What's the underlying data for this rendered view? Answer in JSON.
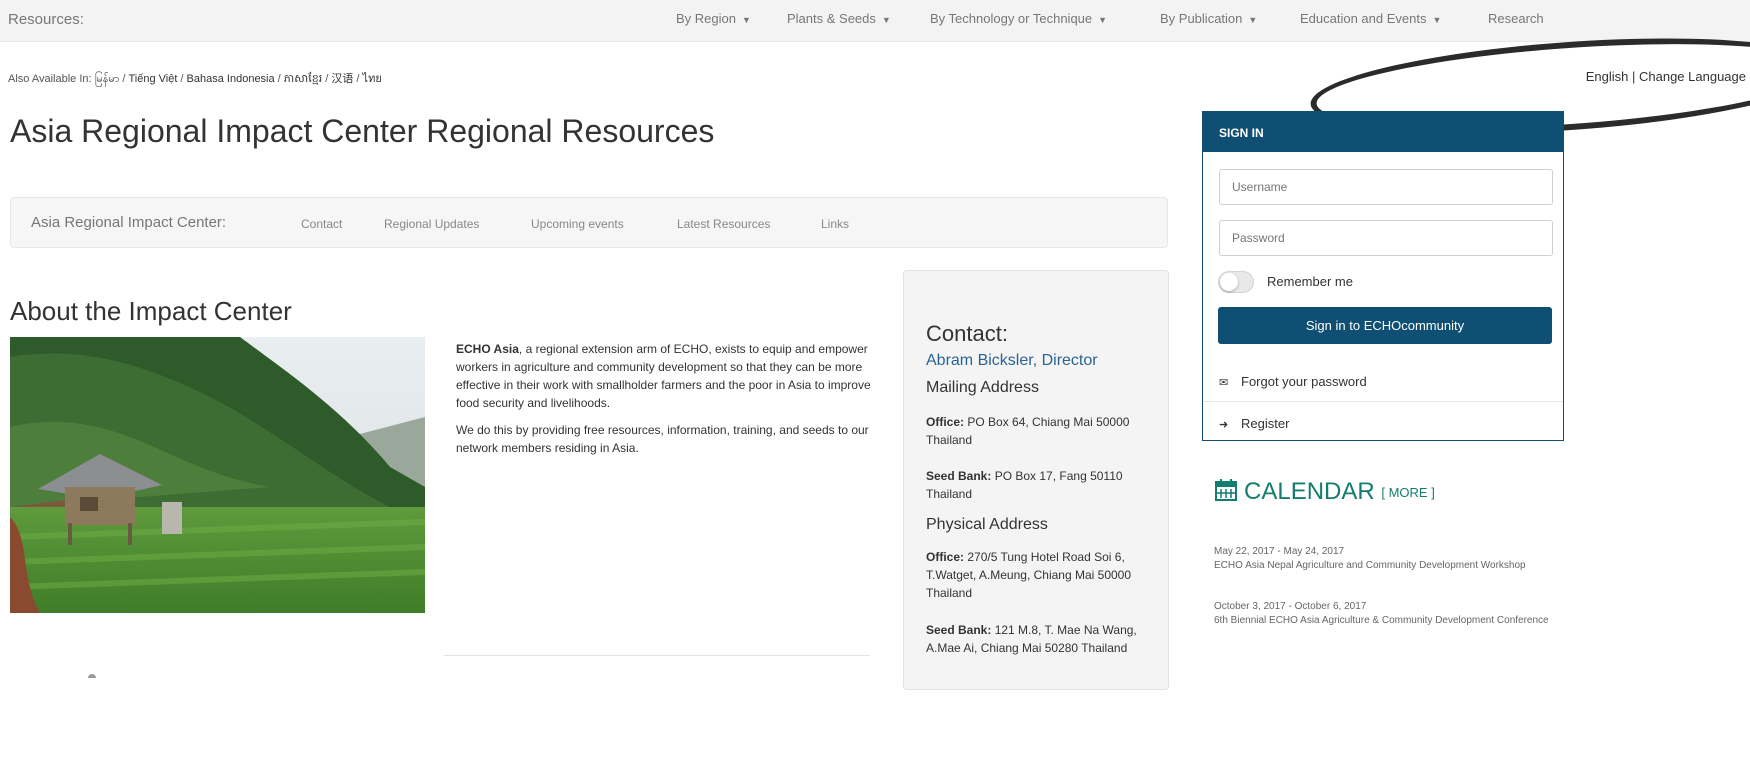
{
  "topnav": {
    "resources_label": "Resources:",
    "menu": [
      {
        "label": "By Region"
      },
      {
        "label": "Plants & Seeds"
      },
      {
        "label": "By Technology or Technique"
      },
      {
        "label": "By Publication"
      },
      {
        "label": "Education and Events"
      },
      {
        "label": "Research"
      }
    ]
  },
  "also_available": {
    "label": "Also Available In:",
    "languages": [
      "မြန်မာ",
      "Tiếng Việt",
      "Bahasa Indonesia",
      "ភាសាខ្មែរ",
      "汉语",
      "ไทย"
    ],
    "separator": " / "
  },
  "language_switch": {
    "current": "English",
    "separator": " | ",
    "change_label": "Change Language"
  },
  "page": {
    "title": "Asia Regional Impact Center Regional Resources"
  },
  "subnav": {
    "brand": "Asia Regional Impact Center:",
    "links": [
      "Contact",
      "Regional Updates",
      "Upcoming events",
      "Latest Resources",
      "Links"
    ]
  },
  "about": {
    "heading": "About the Impact Center",
    "para1_bold": "ECHO Asia",
    "para1_rest": ", a regional extension arm of ECHO, exists to equip and empower workers in agriculture and community development so that they can be more effective in their work with smallholder farmers and the poor in Asia to improve food security and livelihoods.",
    "para2": "We do this by providing free resources, information, training, and seeds to our network members residing in Asia."
  },
  "contact": {
    "heading": "Contact:",
    "director": "Abram Bicksler, Director",
    "mailing_heading": "Mailing Address",
    "mailing": [
      {
        "label": "Office:",
        "text": " PO Box 64, Chiang Mai 50000 Thailand"
      },
      {
        "label": "Seed Bank:",
        "text": " PO Box 17, Fang 50110 Thailand"
      }
    ],
    "physical_heading": "Physical Address",
    "physical": [
      {
        "label": "Office:",
        "text": " 270/5 Tung Hotel Road Soi 6, T.Watget, A.Meung, Chiang Mai 50000 Thailand"
      },
      {
        "label": "Seed Bank:",
        "text": " 121 M.8, T. Mae Na Wang, A.Mae Ai, Chiang Mai 50280 Thailand"
      }
    ]
  },
  "signin": {
    "header": "SIGN IN",
    "username_placeholder": "Username",
    "password_placeholder": "Password",
    "remember_label": "Remember me",
    "remember_checked": false,
    "button_label": "Sign in to ECHOcommunity",
    "forgot_label": "Forgot your password",
    "register_label": "Register"
  },
  "calendar": {
    "title": "CALENDAR",
    "more_label": "[ MORE ]",
    "events": [
      {
        "dates": "May 22, 2017 - May 24, 2017",
        "title": "ECHO Asia Nepal Agriculture and Community Development Workshop"
      },
      {
        "dates": "October 3, 2017 - October 6, 2017",
        "title": "6th Biennial ECHO Asia Agriculture & Community Development Conference"
      }
    ]
  },
  "colors": {
    "signin_blue": "#0f4f73",
    "calendar_green": "#137d6e",
    "link_blue": "#2a6496"
  }
}
